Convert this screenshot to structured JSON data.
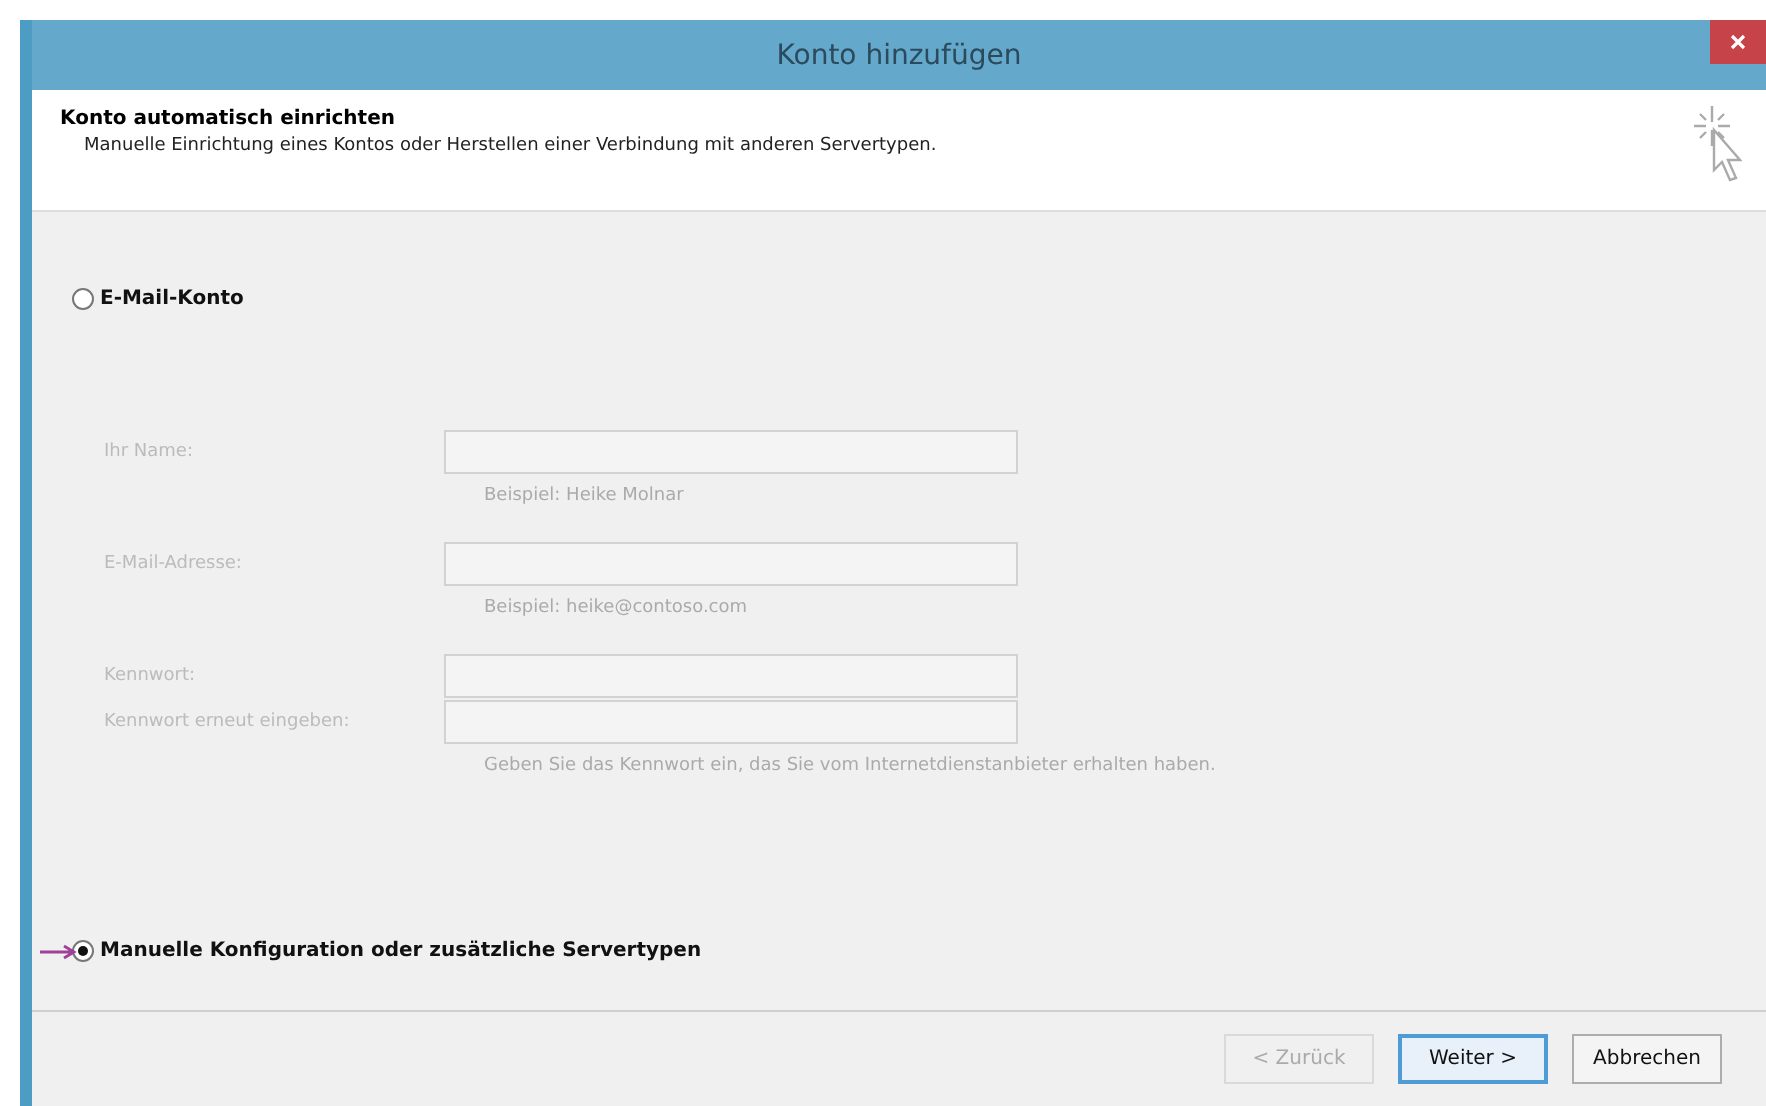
{
  "window": {
    "title": "Konto hinzufügen"
  },
  "header": {
    "title": "Konto automatisch einrichten",
    "subtitle": "Manuelle Einrichtung eines Kontos oder Herstellen einer Verbindung mit anderen Servertypen."
  },
  "options": [
    {
      "label": "E-Mail-Konto",
      "selected": false
    },
    {
      "label": "Manuelle Konfiguration oder zusätzliche Servertypen",
      "selected": true
    }
  ],
  "fields": [
    {
      "label": "Ihr Name:",
      "hint": "Beispiel: Heike Molnar",
      "disabled": true
    },
    {
      "label": "E-Mail-Adresse:",
      "hint": "Beispiel: heike@contoso.com",
      "disabled": true
    },
    {
      "label": "Kennwort:",
      "disabled": true
    },
    {
      "label": "Kennwort erneut eingeben:",
      "hint": "Geben Sie das Kennwort ein, das Sie vom Internetdienstanbieter erhalten haben.",
      "disabled": true
    }
  ],
  "buttons": [
    {
      "label": "< Zurück",
      "disabled": true,
      "default": false
    },
    {
      "label": "Weiter >",
      "disabled": false,
      "default": true
    },
    {
      "label": "Abbrechen",
      "disabled": false,
      "default": false
    }
  ]
}
